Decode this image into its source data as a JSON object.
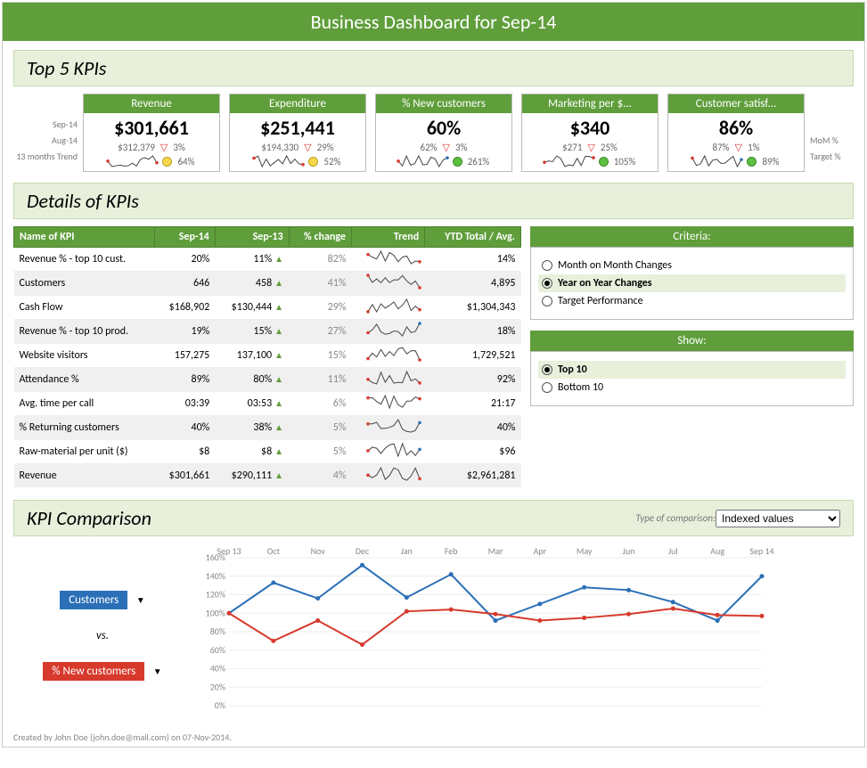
{
  "title": "Business Dashboard for Sep-14",
  "section_top5": "Top 5 KPIs",
  "row_labels_left": {
    "curr": "Sep-14",
    "prev": "Aug-14",
    "trend": "13 months Trend"
  },
  "row_labels_right": {
    "mom": "MoM %",
    "tgt": "Target %"
  },
  "kpis": [
    {
      "name": "Revenue",
      "value": "$301,661",
      "prev": "$312,379",
      "mom": "3%",
      "target": "64%",
      "dot": "yellow"
    },
    {
      "name": "Expenditure",
      "value": "$251,441",
      "prev": "$194,330",
      "mom": "29%",
      "target": "52%",
      "dot": "yellow"
    },
    {
      "name": "% New customers",
      "value": "60%",
      "prev": "62%",
      "mom": "3%",
      "target": "261%",
      "dot": "green"
    },
    {
      "name": "Marketing per $...",
      "value": "$340",
      "prev": "$271",
      "mom": "25%",
      "target": "105%",
      "dot": "green"
    },
    {
      "name": "Customer satisf...",
      "value": "86%",
      "prev": "87%",
      "mom": "1%",
      "target": "89%",
      "dot": "green"
    }
  ],
  "section_details": "Details of KPIs",
  "table_headers": [
    "Name of KPI",
    "Sep-14",
    "Sep-13",
    "% change",
    "Trend",
    "YTD Total / Avg."
  ],
  "table_rows": [
    {
      "name": "Revenue % - top 10 cust.",
      "curr": "20%",
      "prev": "11%",
      "chg": "82%",
      "ytd": "14%"
    },
    {
      "name": "Customers",
      "curr": "646",
      "prev": "458",
      "chg": "41%",
      "ytd": "4,895"
    },
    {
      "name": "Cash Flow",
      "curr": "$168,902",
      "prev": "$130,444",
      "chg": "29%",
      "ytd": "$1,304,343"
    },
    {
      "name": "Revenue % - top 10 prod.",
      "curr": "19%",
      "prev": "15%",
      "chg": "27%",
      "ytd": "18%"
    },
    {
      "name": "Website visitors",
      "curr": "157,275",
      "prev": "137,100",
      "chg": "15%",
      "ytd": "1,729,521"
    },
    {
      "name": "Attendance %",
      "curr": "89%",
      "prev": "80%",
      "chg": "11%",
      "ytd": "92%"
    },
    {
      "name": "Avg. time per call",
      "curr": "03:39",
      "prev": "03:53",
      "chg": "6%",
      "ytd": "21:17"
    },
    {
      "name": "% Returning customers",
      "curr": "40%",
      "prev": "38%",
      "chg": "5%",
      "ytd": "40%"
    },
    {
      "name": "Raw-material per unit ($)",
      "curr": "$8",
      "prev": "$8",
      "chg": "5%",
      "ytd": "$96"
    },
    {
      "name": "Revenue",
      "curr": "$301,661",
      "prev": "$290,111",
      "chg": "4%",
      "ytd": "$2,961,281"
    }
  ],
  "criteria_title": "Criteria:",
  "criteria_options": [
    "Month on Month Changes",
    "Year on Year Changes",
    "Target Performance"
  ],
  "criteria_selected": 1,
  "show_title": "Show:",
  "show_options": [
    "Top 10",
    "Bottom 10"
  ],
  "show_selected": 0,
  "section_comparison": "KPI Comparison",
  "typecomp_label": "Type of comparison:",
  "typecomp_value": "Indexed values",
  "comp_a": "Customers",
  "comp_vs": "vs.",
  "comp_b": "% New customers",
  "footer": "Created by John Doe (john.doe@mail.com) on 07-Nov-2014.",
  "chart_data": {
    "type": "line",
    "title": "KPI Comparison (Indexed)",
    "xlabel": "",
    "ylabel": "%",
    "categories": [
      "Sep 13",
      "Oct",
      "Nov",
      "Dec",
      "Jan",
      "Feb",
      "Mar",
      "Apr",
      "May",
      "Jun",
      "Jul",
      "Aug",
      "Sep 14"
    ],
    "ylim": [
      0,
      160
    ],
    "yticks": [
      0,
      20,
      40,
      60,
      80,
      100,
      120,
      140,
      160
    ],
    "series": [
      {
        "name": "Customers",
        "color": "#2b6fb8",
        "values": [
          100,
          133,
          116,
          152,
          117,
          142,
          92,
          110,
          128,
          125,
          112,
          92,
          140
        ]
      },
      {
        "name": "% New customers",
        "color": "#d73a2d",
        "values": [
          100,
          70,
          92,
          66,
          102,
          104,
          99,
          92,
          95,
          99,
          105,
          98,
          97
        ]
      }
    ]
  }
}
